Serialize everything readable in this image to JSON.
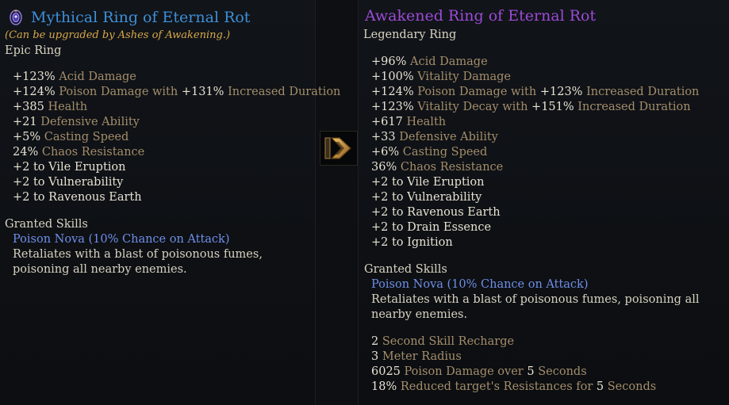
{
  "left": {
    "title": "Mythical Ring of Eternal Rot",
    "note": "(Can be upgraded by Ashes of Awakening.)",
    "subtitle": "Epic Ring",
    "stats": [
      {
        "parts": [
          [
            "v",
            "+123% "
          ],
          [
            "t",
            "Acid Damage"
          ]
        ]
      },
      {
        "parts": [
          [
            "v",
            "+124% "
          ],
          [
            "t",
            "Poison Damage with "
          ],
          [
            "v",
            "+131% "
          ],
          [
            "t",
            "Increased Duration"
          ]
        ]
      },
      {
        "parts": [
          [
            "v",
            "+385 "
          ],
          [
            "t",
            "Health"
          ]
        ]
      },
      {
        "parts": [
          [
            "v",
            "+21 "
          ],
          [
            "t",
            "Defensive Ability"
          ]
        ]
      },
      {
        "parts": [
          [
            "v",
            "+5% "
          ],
          [
            "t",
            "Casting Speed"
          ]
        ]
      },
      {
        "parts": [
          [
            "v",
            "24% "
          ],
          [
            "t",
            "Chaos Resistance"
          ]
        ]
      },
      {
        "parts": [
          [
            "v",
            "+2 to Vile Eruption"
          ]
        ]
      },
      {
        "parts": [
          [
            "v",
            "+2 to Vulnerability"
          ]
        ]
      },
      {
        "parts": [
          [
            "v",
            "+2 to Ravenous Earth"
          ]
        ]
      }
    ],
    "granted_label": "Granted Skills",
    "skill_name": "Poison Nova (10% Chance on Attack)",
    "skill_desc": "Retaliates with a blast of poisonous fumes, poisoning all nearby enemies."
  },
  "right": {
    "title": "Awakened Ring of Eternal Rot",
    "subtitle": "Legendary Ring",
    "stats": [
      {
        "parts": [
          [
            "v",
            "+96% "
          ],
          [
            "t",
            "Acid Damage"
          ]
        ]
      },
      {
        "parts": [
          [
            "v",
            "+100% "
          ],
          [
            "t",
            "Vitality Damage"
          ]
        ]
      },
      {
        "parts": [
          [
            "v",
            "+124% "
          ],
          [
            "t",
            "Poison Damage with "
          ],
          [
            "v",
            "+123% "
          ],
          [
            "t",
            "Increased Duration"
          ]
        ]
      },
      {
        "parts": [
          [
            "v",
            "+123% "
          ],
          [
            "t",
            "Vitality Decay with "
          ],
          [
            "v",
            "+151% "
          ],
          [
            "t",
            "Increased Duration"
          ]
        ]
      },
      {
        "parts": [
          [
            "v",
            "+617 "
          ],
          [
            "t",
            "Health"
          ]
        ]
      },
      {
        "parts": [
          [
            "v",
            "+33 "
          ],
          [
            "t",
            "Defensive Ability"
          ]
        ]
      },
      {
        "parts": [
          [
            "v",
            "+6% "
          ],
          [
            "t",
            "Casting Speed"
          ]
        ]
      },
      {
        "parts": [
          [
            "v",
            "36% "
          ],
          [
            "t",
            "Chaos Resistance"
          ]
        ]
      },
      {
        "parts": [
          [
            "v",
            "+2 to Vile Eruption"
          ]
        ]
      },
      {
        "parts": [
          [
            "v",
            "+2 to Vulnerability"
          ]
        ]
      },
      {
        "parts": [
          [
            "v",
            "+2 to Ravenous Earth"
          ]
        ]
      },
      {
        "parts": [
          [
            "v",
            "+2 to Drain Essence"
          ]
        ]
      },
      {
        "parts": [
          [
            "v",
            "+2 to Ignition"
          ]
        ]
      }
    ],
    "granted_label": "Granted Skills",
    "skill_name": "Poison Nova (10% Chance on Attack)",
    "skill_desc": "Retaliates with a blast of poisonous fumes, poisoning all nearby enemies.",
    "skill_stats": [
      {
        "parts": [
          [
            "v",
            "2 "
          ],
          [
            "t",
            "Second Skill Recharge"
          ]
        ]
      },
      {
        "parts": [
          [
            "v",
            "3 "
          ],
          [
            "t",
            "Meter Radius"
          ]
        ]
      },
      {
        "parts": [
          [
            "v",
            "6025 "
          ],
          [
            "t",
            "Poison Damage over "
          ],
          [
            "v",
            "5 "
          ],
          [
            "t",
            "Seconds"
          ]
        ]
      },
      {
        "parts": [
          [
            "v",
            "18% "
          ],
          [
            "t",
            "Reduced target's Resistances for "
          ],
          [
            "v",
            "5 "
          ],
          [
            "t",
            "Seconds"
          ]
        ]
      }
    ]
  },
  "colors": {
    "epic": "#3e8fd8",
    "legendary": "#9b4bd6",
    "note": "#d9a84a",
    "stat_value": "#e8e2d3",
    "stat_text": "#a48e6b",
    "skill": "#6f8fe8"
  },
  "icons": {
    "item_icon": "jeweled-amulet-icon",
    "arrow": "upgrade-arrow-icon"
  }
}
